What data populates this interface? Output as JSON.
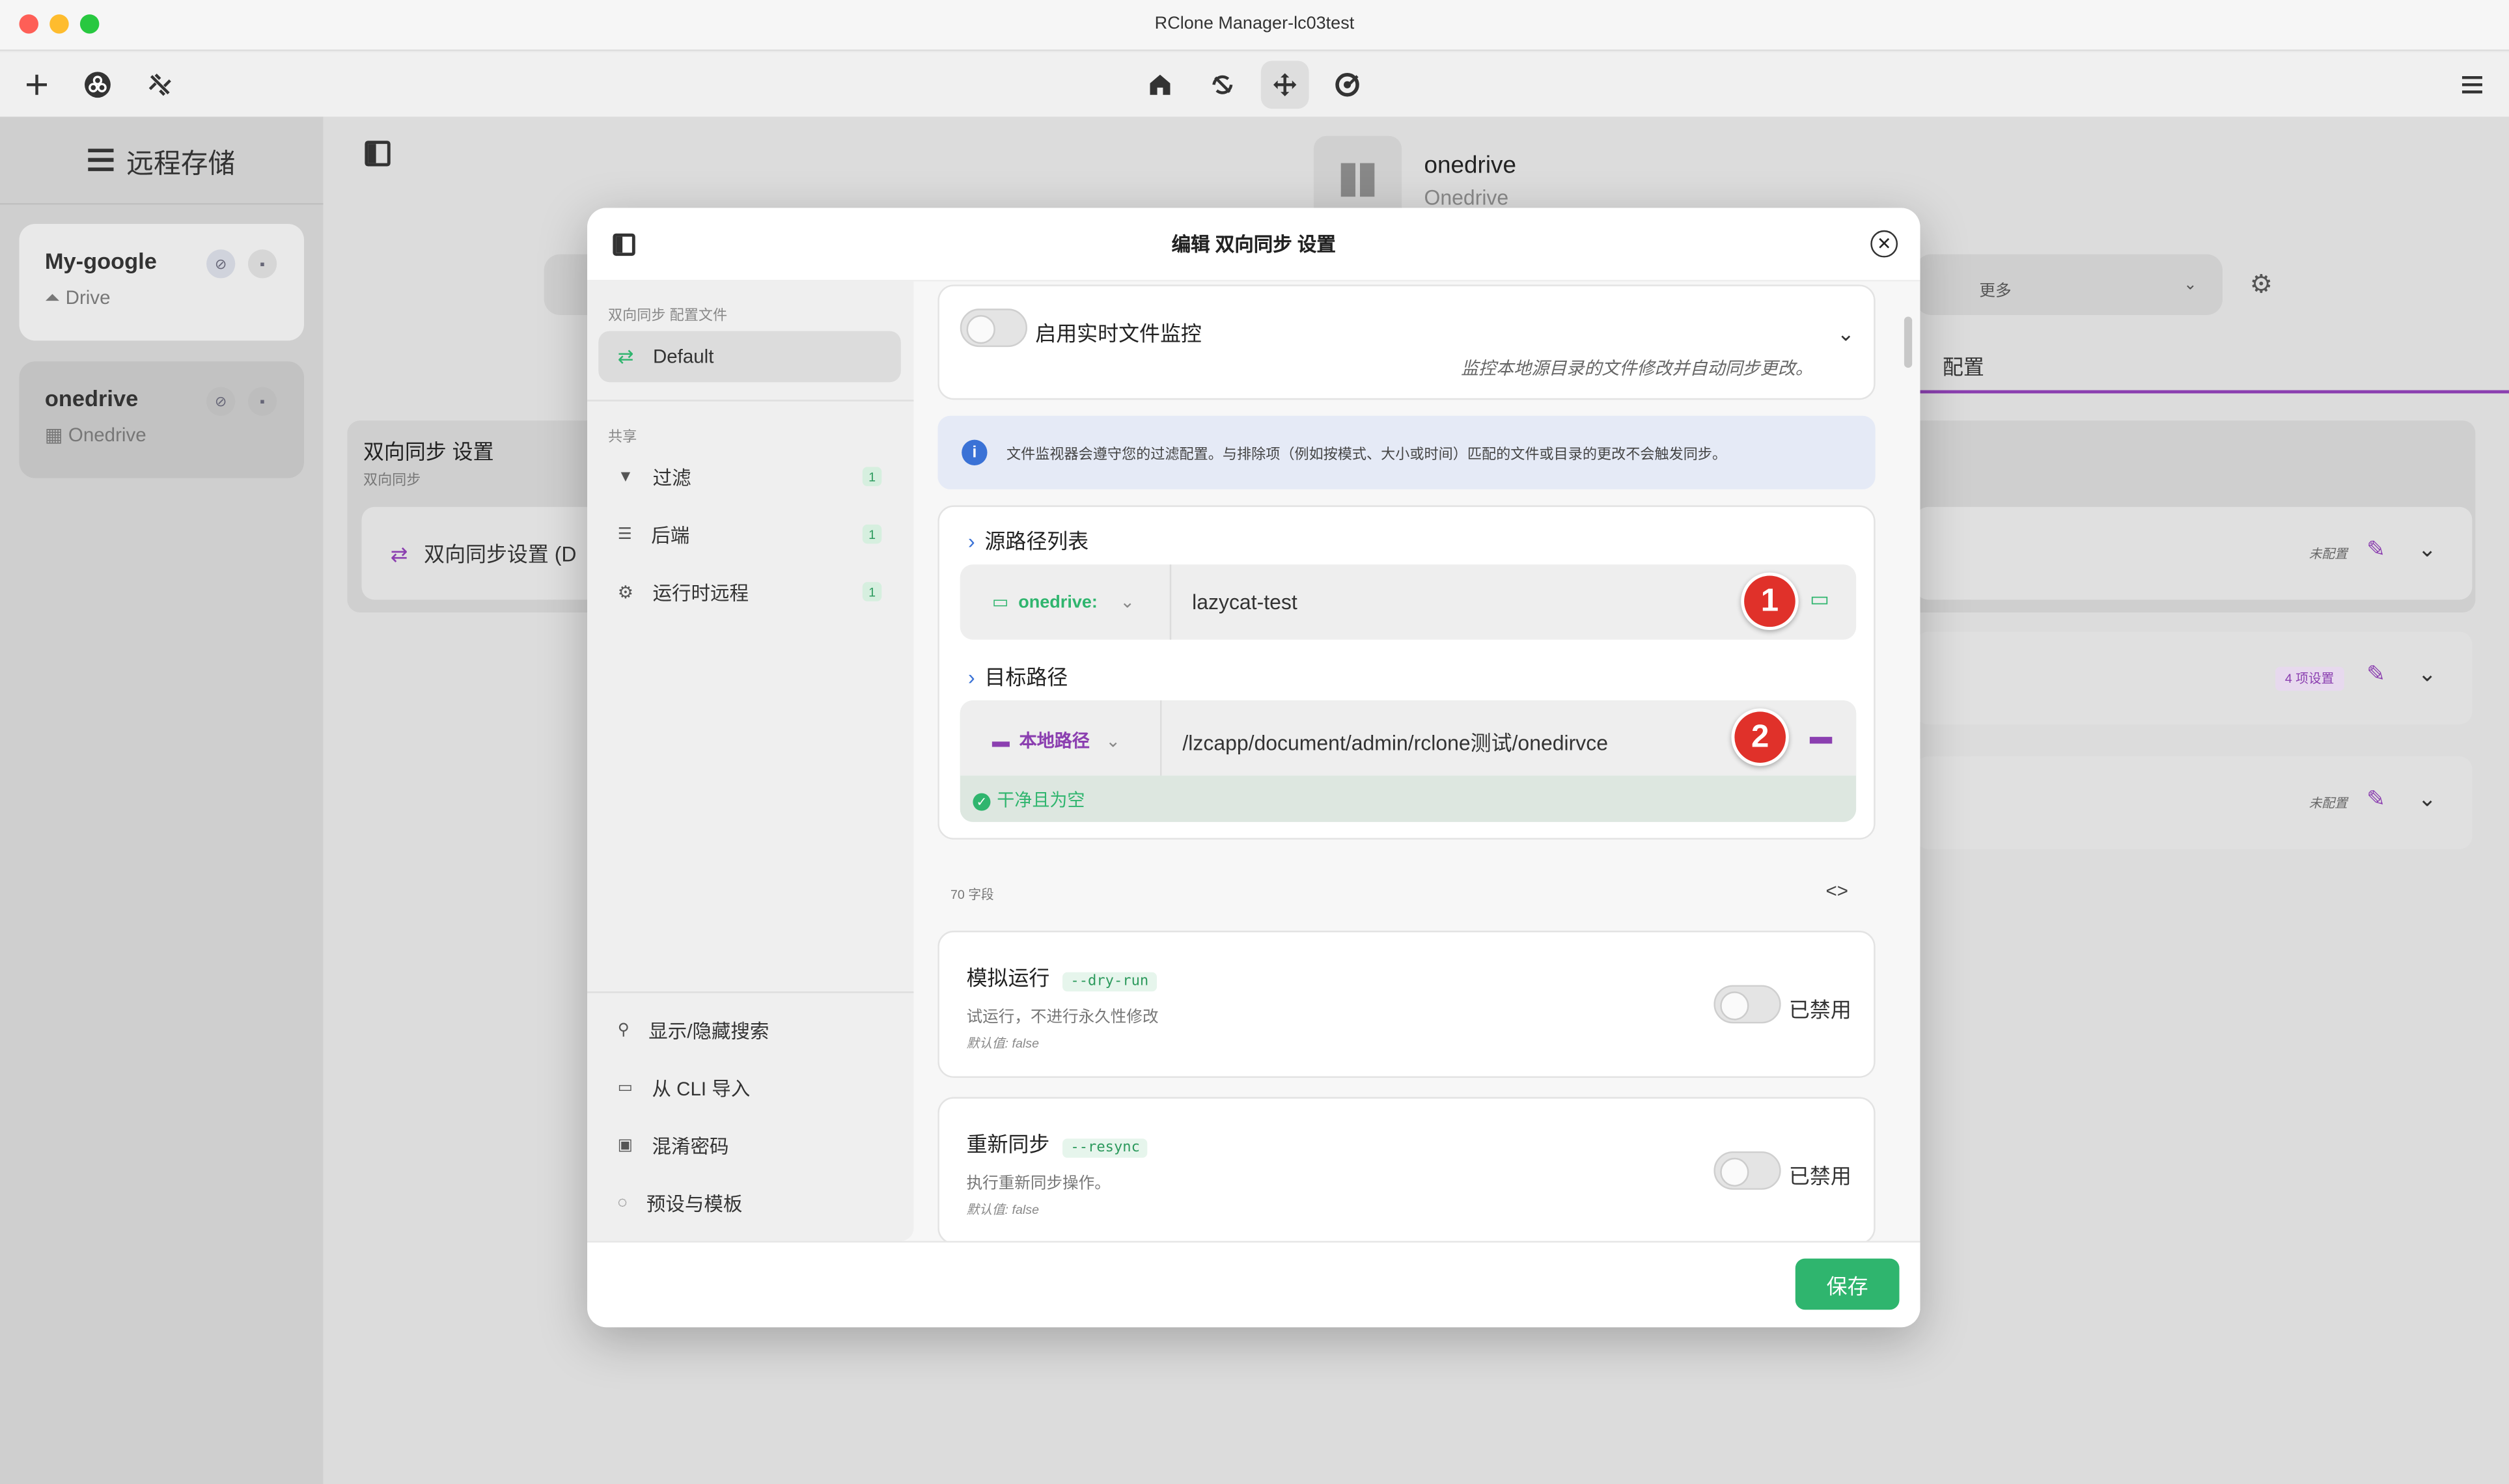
{
  "window": {
    "title": "RClone Manager-lc03test"
  },
  "sidebar": {
    "title": "远程存储",
    "remotes": [
      {
        "name": "My-google",
        "type": "Drive"
      },
      {
        "name": "onedrive",
        "type": "Onedrive"
      }
    ]
  },
  "background": {
    "remote_name": "onedrive",
    "remote_type": "Onedrive",
    "more_select": "更多",
    "tab_config": "配置",
    "section_title": "双向同步 设置",
    "section_sub": "双向同步",
    "item_label": "双向同步设置 (D",
    "row_badges": [
      "未配置",
      "4 项设置",
      "未配置"
    ]
  },
  "modal": {
    "title": "编辑 双向同步 设置",
    "left": {
      "profiles_title": "双向同步 配置文件",
      "profile_default": "Default",
      "shared_title": "共享",
      "shared_items": [
        {
          "label": "过滤",
          "count": "1"
        },
        {
          "label": "后端",
          "count": "1"
        },
        {
          "label": "运行时远程",
          "count": "1"
        }
      ],
      "bottom_items": [
        "显示/隐藏搜索",
        "从 CLI 导入",
        "混淆密码",
        "预设与模板"
      ]
    },
    "watch": {
      "label": "启用实时文件监控",
      "desc": "监控本地源目录的文件修改并自动同步更改。"
    },
    "info": "文件监视器会遵守您的过滤配置。与排除项（例如按模式、大小或时间）匹配的文件或目录的更改不会触发同步。",
    "source": {
      "title": "源路径列表",
      "remote": "onedrive:",
      "path": "lazycat-test",
      "marker": "1"
    },
    "target": {
      "title": "目标路径",
      "remote": "本地路径",
      "path": "/lzcapp/document/admin/rclone测试/onedirvce",
      "marker": "2",
      "status": "干净且为空"
    },
    "fields_count": "70 字段",
    "options": [
      {
        "title": "模拟运行",
        "flag": "--dry-run",
        "desc": "试运行，不进行永久性修改",
        "default": "默认值: false",
        "state": "已禁用"
      },
      {
        "title": "重新同步",
        "flag": "--resync",
        "desc": "执行重新同步操作。",
        "default": "默认值: false",
        "state": "已禁用"
      }
    ],
    "save": "保存"
  },
  "colors": {
    "accent_green": "#2fb56e",
    "purple": "#8b3fb0",
    "marker_red": "#e0312a"
  }
}
